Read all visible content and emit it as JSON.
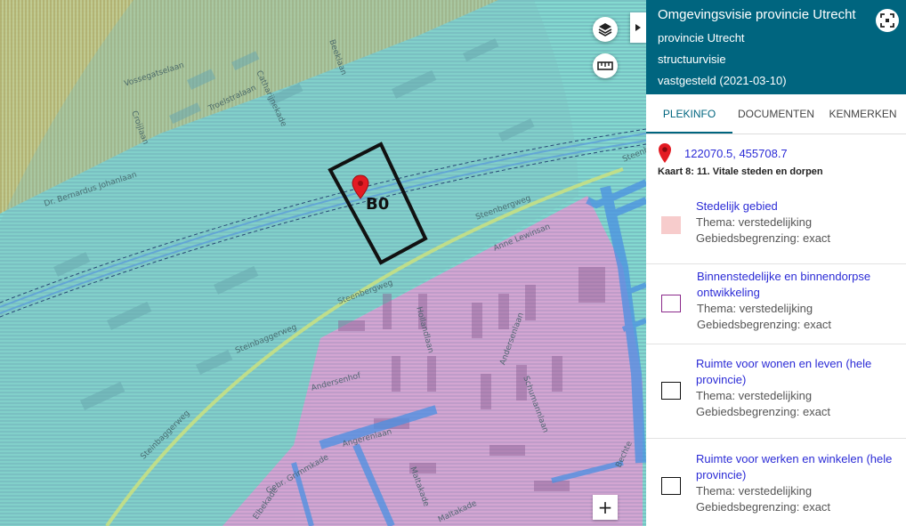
{
  "map": {
    "marker_label": "B0",
    "street_labels": [
      "Vossegatselaan",
      "Croijlaan",
      "Troelstralaan",
      "Catharijnekade",
      "Beeklaan",
      "Dr. Bernardus Johanlaan",
      "Steenbergweg",
      "Steenbergweg",
      "Steinbaggerweg",
      "Anne Lewinsan",
      "Steinbaggerweg",
      "Andersenhof",
      "Andersenlaan",
      "Schumannlaan",
      "Angerenlaan",
      "Gebr. Grimmkade",
      "Elbekade",
      "Maltakade",
      "Maltakade",
      "Bechte",
      "Steenbaggerweg",
      "Hollandlaan"
    ],
    "buttons": {
      "layers": "layers-icon",
      "measure": "ruler-icon",
      "zoom_in": "+",
      "collapse": "chevron-right-icon"
    },
    "colors": {
      "cyan_overlay": "#7fd4cc",
      "pink_overlay": "#d6a5d6",
      "road_blue": "#4a90e2",
      "marker_red": "#e31b23"
    }
  },
  "panel": {
    "title": "Omgevingsvisie provincie Utrecht",
    "owner": "provincie Utrecht",
    "type": "structuurvisie",
    "status": "vastgesteld (2021-03-10)",
    "header_color": "#00657f",
    "tabs": [
      {
        "label": "PLEKINFO",
        "active": true
      },
      {
        "label": "DOCUMENTEN",
        "active": false
      },
      {
        "label": "KENMERKEN",
        "active": false
      }
    ],
    "coordinates": "122070.5, 455708.7",
    "kaart": "Kaart 8: 11. Vitale steden en dorpen",
    "entries": [
      {
        "title": "Stedelijk gebied",
        "thema": "Thema: verstedelijking",
        "begrenzing": "Gebiedsbegrenzing: exact",
        "swatch_fill": "#f7cccc",
        "swatch_border": "#f7cccc"
      },
      {
        "title": "Binnenstedelijke en binnendorpse ontwikkeling",
        "thema": "Thema: verstedelijking",
        "begrenzing": "Gebiedsbegrenzing: exact",
        "swatch_fill": "#ffffff",
        "swatch_border": "#8b2a8b"
      },
      {
        "title": "Ruimte voor wonen en leven (hele provincie)",
        "thema": "Thema: verstedelijking",
        "begrenzing": "Gebiedsbegrenzing: exact",
        "swatch_fill": "#ffffff",
        "swatch_border": "#111111"
      },
      {
        "title": "Ruimte voor werken en winkelen (hele provincie)",
        "thema": "Thema: verstedelijking",
        "begrenzing": "Gebiedsbegrenzing: exact",
        "swatch_fill": "#ffffff",
        "swatch_border": "#111111"
      }
    ]
  }
}
